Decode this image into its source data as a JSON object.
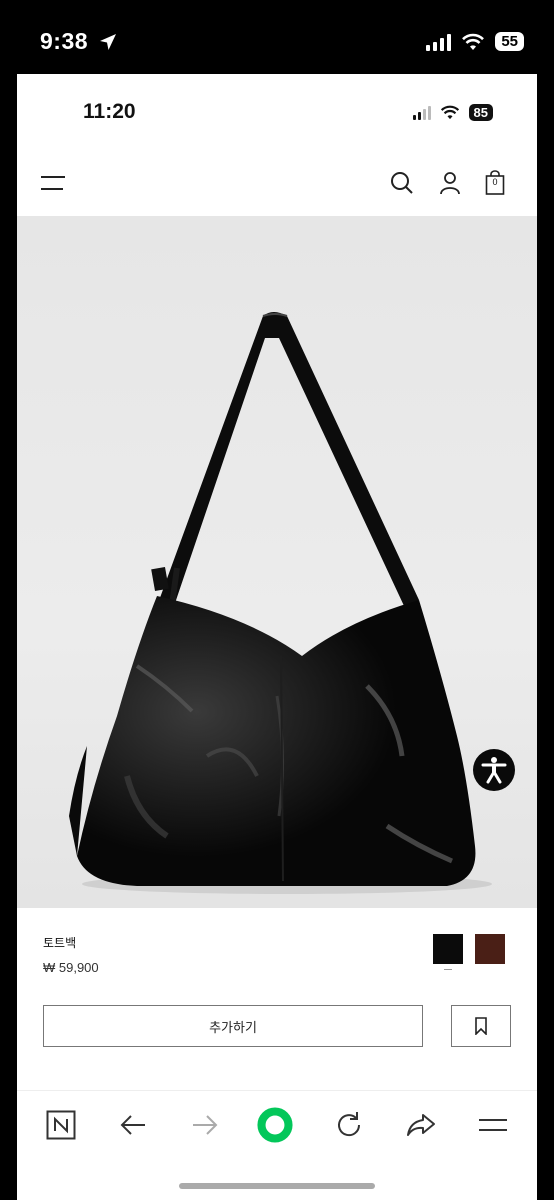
{
  "outer_status": {
    "time": "9:38",
    "battery": "55"
  },
  "inner_status": {
    "time": "11:20",
    "battery": "85"
  },
  "header": {
    "cart_count": "0"
  },
  "product": {
    "name": "토트백",
    "price": "₩ 59,900",
    "colors": [
      "#0b0b0b",
      "#4a1f16"
    ],
    "selected_color_index": 0
  },
  "actions": {
    "add_label": "추가하기"
  },
  "browser_toolbar": {
    "icons": [
      "naver-n-icon",
      "back-arrow-icon",
      "forward-arrow-icon",
      "green-home-icon",
      "reload-icon",
      "share-icon",
      "menu-icon"
    ],
    "accent": "#03c75a"
  }
}
